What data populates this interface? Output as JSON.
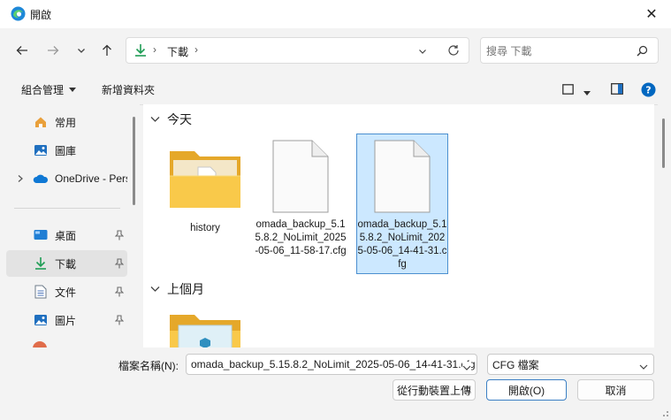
{
  "window": {
    "title": "開啟"
  },
  "address": {
    "folder": "下載"
  },
  "search": {
    "placeholder": "搜尋 下載"
  },
  "toolbar": {
    "organize": "組合管理",
    "new_folder": "新增資料夾"
  },
  "sidebar": {
    "items": [
      {
        "label": "常用",
        "icon": "home-icon"
      },
      {
        "label": "圖庫",
        "icon": "gallery-icon"
      },
      {
        "label": "OneDrive - Pers",
        "icon": "onedrive-icon"
      },
      {
        "label": "桌面",
        "icon": "desktop-icon",
        "pinned": true
      },
      {
        "label": "下載",
        "icon": "download-icon",
        "pinned": true,
        "selected": true
      },
      {
        "label": "文件",
        "icon": "document-icon",
        "pinned": true
      },
      {
        "label": "圖片",
        "icon": "pictures-icon",
        "pinned": true
      }
    ]
  },
  "groups": [
    {
      "label": "今天"
    },
    {
      "label": "上個月"
    }
  ],
  "files": [
    {
      "name": "history",
      "type": "folder"
    },
    {
      "name": "omada_backup_5.15.8.2_NoLimit_2025-05-06_11-58-17.cfg",
      "type": "file"
    },
    {
      "name": "omada_backup_5.15.8.2_NoLimit_2025-05-06_14-41-31.cfg",
      "type": "file",
      "selected": true
    }
  ],
  "footer": {
    "filename_label": "檔案名稱(N):",
    "filename_value": "omada_backup_5.15.8.2_NoLimit_2025-05-06_14-41-31.cfg",
    "filetype_value": "CFG 檔案",
    "upload_button": "從行動裝置上傳",
    "open_button": "開啟(O)",
    "cancel_button": "取消"
  },
  "colors": {
    "accent": "#0067c0",
    "selection": "#cce8ff",
    "folder": "#f8c443"
  }
}
